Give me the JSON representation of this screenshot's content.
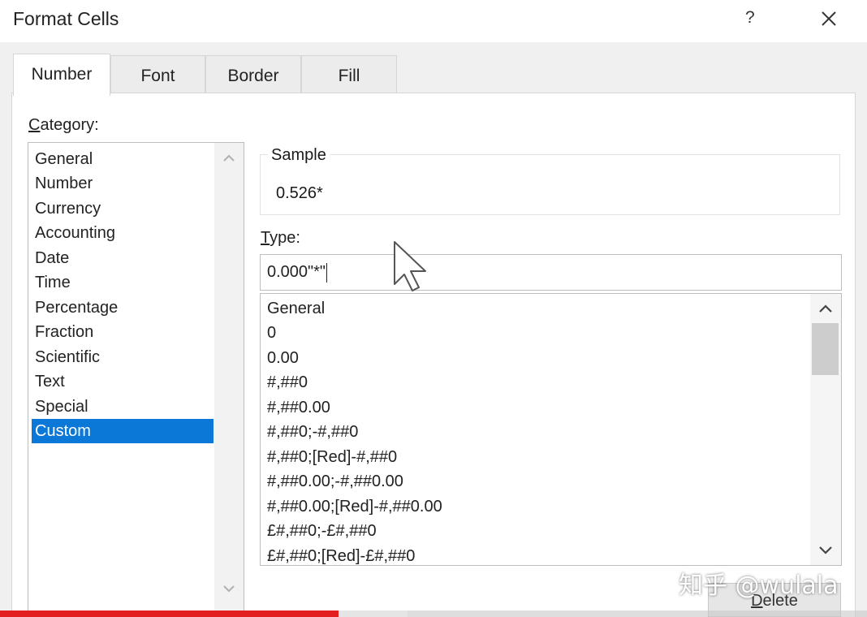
{
  "window": {
    "title": "Format Cells",
    "help_label": "?",
    "close_icon": "close-icon"
  },
  "tabs": [
    {
      "label": "Number",
      "active": true
    },
    {
      "label": "Font",
      "active": false
    },
    {
      "label": "Border",
      "active": false
    },
    {
      "label": "Fill",
      "active": false
    }
  ],
  "category": {
    "label_first": "C",
    "label_rest": "ategory:",
    "items": [
      "General",
      "Number",
      "Currency",
      "Accounting",
      "Date",
      "Time",
      "Percentage",
      "Fraction",
      "Scientific",
      "Text",
      "Special",
      "Custom"
    ],
    "selected": "Custom",
    "scroll_up_icon": "chevron-up-icon",
    "scroll_down_icon": "chevron-down-icon"
  },
  "sample": {
    "label": "Sample",
    "value": "0.526*"
  },
  "type": {
    "label_first": "T",
    "label_rest": "ype:",
    "value": "0.000\"*\""
  },
  "format_list": {
    "items": [
      "General",
      "0",
      "0.00",
      "#,##0",
      "#,##0.00",
      "#,##0;-#,##0",
      "#,##0;[Red]-#,##0",
      "#,##0.00;-#,##0.00",
      "#,##0.00;[Red]-#,##0.00",
      "£#,##0;-£#,##0",
      "£#,##0;[Red]-£#,##0"
    ],
    "scroll_up_icon": "chevron-up-icon",
    "scroll_down_icon": "chevron-down-icon"
  },
  "buttons": {
    "delete_first": "D",
    "delete_rest": "elete"
  },
  "watermark": "知乎 @wulala",
  "video_progress": {
    "played_fraction": 0.39,
    "buffered_fraction": 0.47,
    "played_color": "#e31f1f"
  },
  "colors": {
    "selection": "#0b78d7",
    "window_bg": "#f0f0f0"
  }
}
